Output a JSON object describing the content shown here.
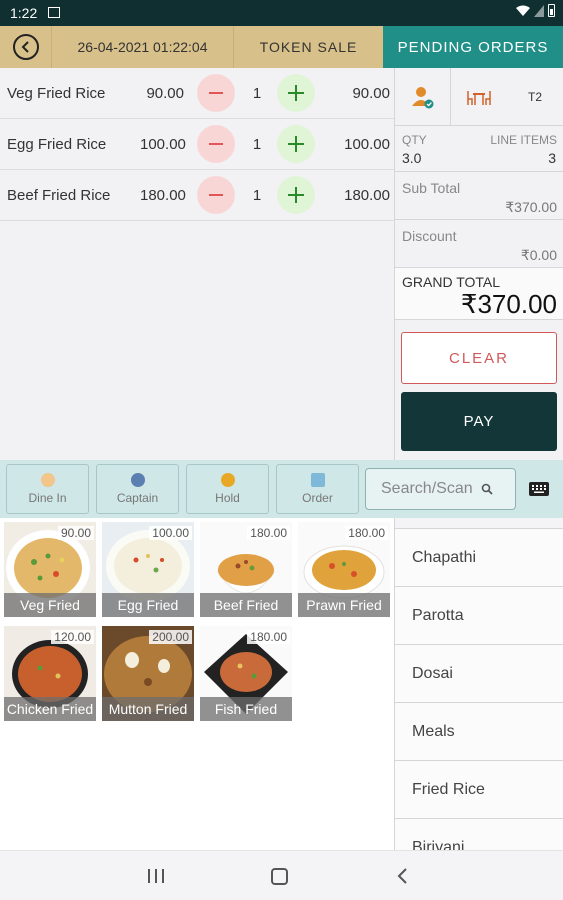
{
  "status_bar": {
    "time": "1:22"
  },
  "header": {
    "datetime": "26-04-2021 01:22:04",
    "token_sale": "TOKEN SALE",
    "pending_orders": "PENDING ORDERS"
  },
  "order_lines": [
    {
      "name": "Veg Fried Rice",
      "price": "90.00",
      "qty": "1",
      "total": "90.00"
    },
    {
      "name": "Egg Fried Rice",
      "price": "100.00",
      "qty": "1",
      "total": "100.00"
    },
    {
      "name": "Beef Fried Rice",
      "price": "180.00",
      "qty": "1",
      "total": "180.00"
    }
  ],
  "summary": {
    "table": "T2",
    "qty_label": "QTY",
    "qty_value": "3.0",
    "line_items_label": "LINE ITEMS",
    "line_items_value": "3",
    "subtotal_label": "Sub Total",
    "subtotal_value": "₹370.00",
    "discount_label": "Discount",
    "discount_value": "₹0.00",
    "grand_total_label": "GRAND TOTAL",
    "grand_total_value": "₹370.00",
    "clear_label": "CLEAR",
    "pay_label": "PAY"
  },
  "actions": {
    "dine_in": "Dine In",
    "captain": "Captain",
    "hold": "Hold",
    "order": "Order",
    "search_placeholder": "Search/Scan"
  },
  "products": [
    {
      "name": "Veg Fried",
      "price": "90.00"
    },
    {
      "name": "Egg Fried",
      "price": "100.00"
    },
    {
      "name": "Beef Fried",
      "price": "180.00"
    },
    {
      "name": "Prawn Fried",
      "price": "180.00"
    },
    {
      "name": "Chicken Fried",
      "price": "120.00"
    },
    {
      "name": "Mutton Fried",
      "price": "200.00"
    },
    {
      "name": "Fish Fried",
      "price": "180.00"
    }
  ],
  "categories": [
    "Chapathi",
    "Parotta",
    "Dosai",
    "Meals",
    "Fried Rice",
    "Biriyani"
  ],
  "colors": {
    "header_tan": "#d8c08a",
    "pending_teal": "#1f8f88",
    "pay_dark": "#133738",
    "clear_red": "#d05a5a",
    "action_bar": "#cfe7e6"
  }
}
